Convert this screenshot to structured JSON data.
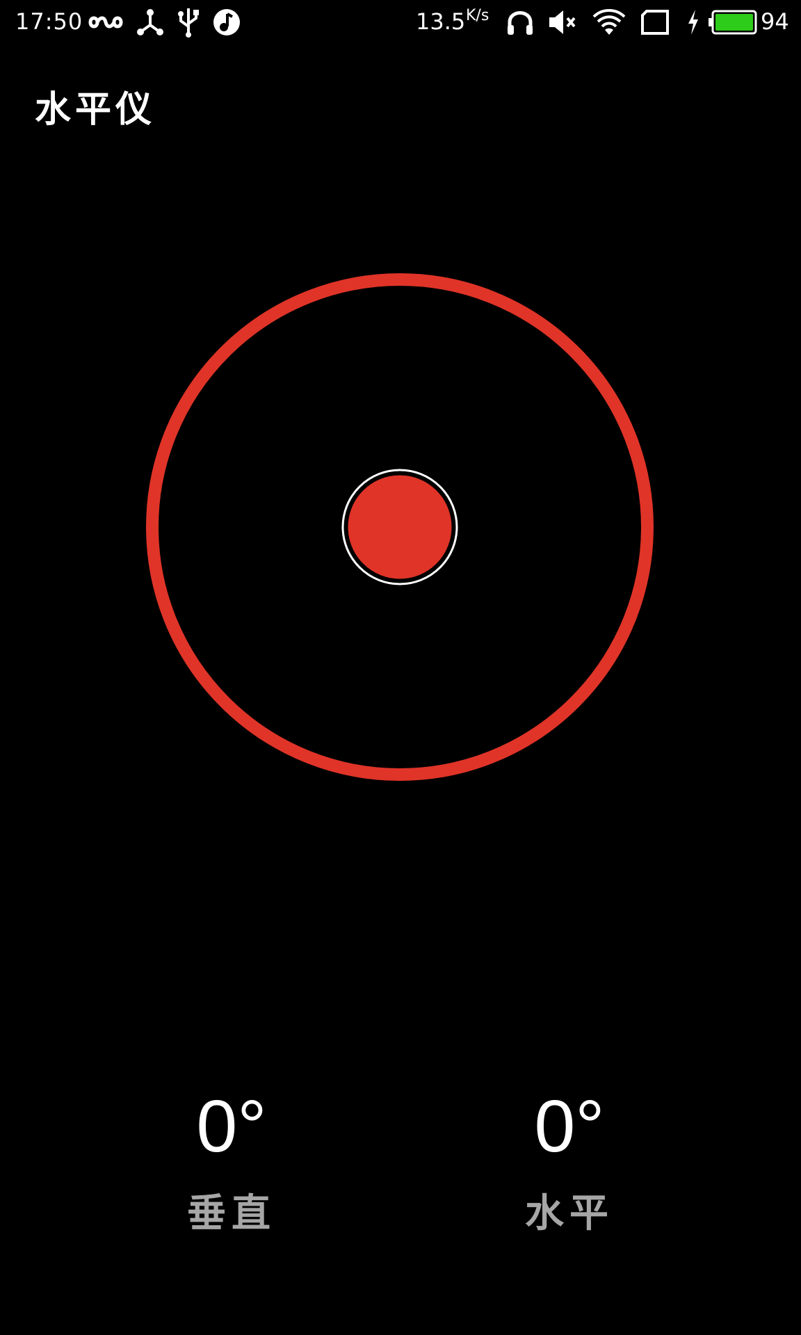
{
  "status_bar": {
    "time": "17:50",
    "net_speed": "13.5",
    "net_speed_unit": "K/s",
    "battery_percent": "94",
    "icons": [
      "infinity-icon",
      "share-icon",
      "usb-icon",
      "music-icon",
      "headphones-icon",
      "mute-icon",
      "wifi-icon",
      "sim-icon",
      "charging-icon",
      "battery-icon"
    ],
    "battery_color": "#2ecc1a"
  },
  "app": {
    "title": "水平仪"
  },
  "level": {
    "ring_color": "#e03428",
    "bubble_color": "#e03428",
    "bubble_offset_x": 0,
    "bubble_offset_y": 0
  },
  "readouts": {
    "vertical": {
      "value": "0°",
      "label": "垂直"
    },
    "horizontal": {
      "value": "0°",
      "label": "水平"
    }
  }
}
